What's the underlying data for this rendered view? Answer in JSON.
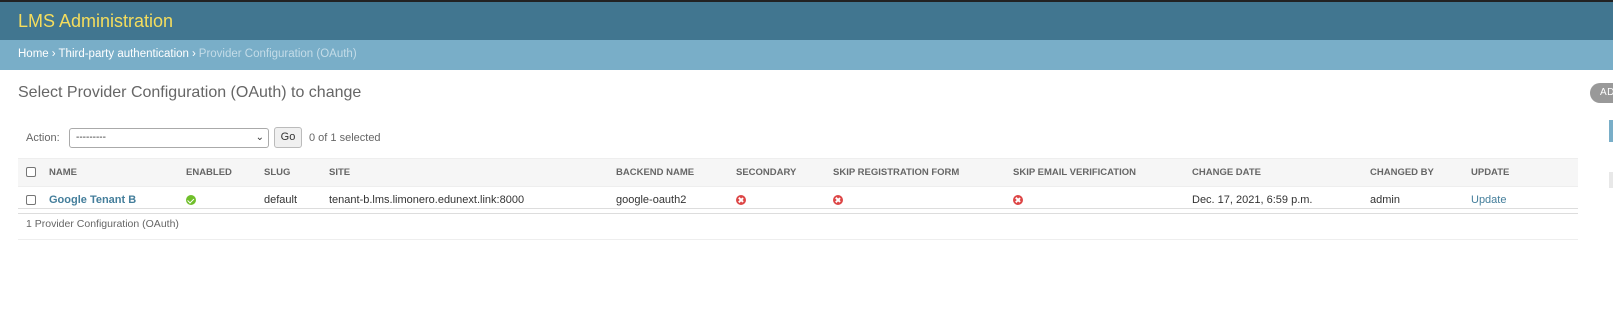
{
  "header": {
    "site_name": "LMS Administration"
  },
  "breadcrumbs": {
    "home": "Home",
    "section": "Third-party authentication",
    "current": "Provider Configuration (OAuth)",
    "separator": "›"
  },
  "page": {
    "title": "Select Provider Configuration (OAuth) to change",
    "add_button": "AD"
  },
  "actions": {
    "label": "Action:",
    "selected_value": "---------",
    "go_button": "Go",
    "selection_counter": "0 of 1 selected"
  },
  "table": {
    "columns": [
      "Name",
      "Enabled",
      "Slug",
      "Site",
      "Backend name",
      "Secondary",
      "Skip registration form",
      "Skip email verification",
      "Change date",
      "Changed by",
      "Update"
    ],
    "rows": [
      {
        "name": "Google Tenant B",
        "enabled": true,
        "slug": "default",
        "site": "tenant-b.lms.limonero.edunext.link:8000",
        "backend_name": "google-oauth2",
        "secondary": false,
        "skip_registration_form": false,
        "skip_email_verification": false,
        "change_date": "Dec. 17, 2021, 6:59 p.m.",
        "changed_by": "admin",
        "update": "Update"
      }
    ]
  },
  "paginator": {
    "text": "1 Provider Configuration (OAuth)"
  },
  "colors": {
    "header_bg": "#417690",
    "site_name": "#f5dd5d",
    "breadcrumbs_bg": "#79aec8",
    "link": "#447e9b",
    "yes_icon": "#70bf2b",
    "no_icon": "#dd4646"
  },
  "icons": {
    "enabled": "check-circle-icon",
    "disabled": "x-circle-icon",
    "select_chevron": "chevron-down-icon"
  }
}
